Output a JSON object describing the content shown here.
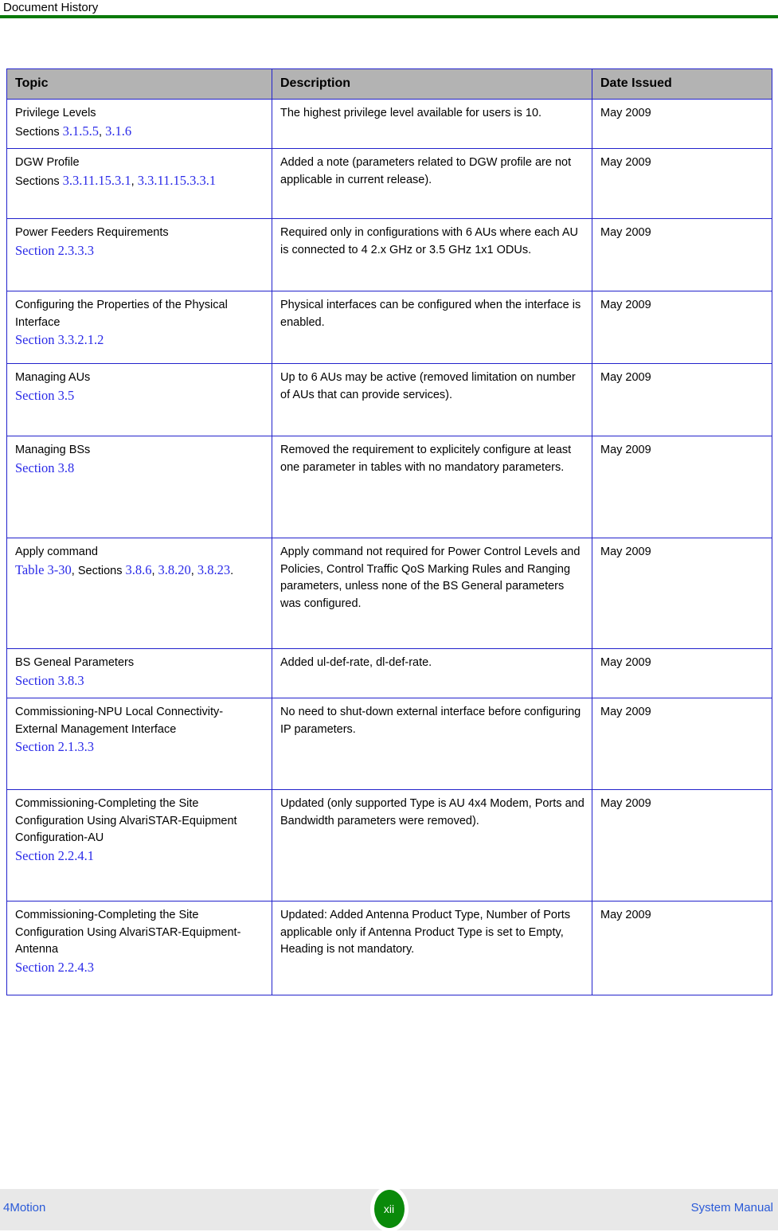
{
  "header": {
    "title": "Document History",
    "rule_color": "#0a7a0a"
  },
  "colors": {
    "link_blue": "#2a2ae8",
    "footer_link_blue": "#2a5ad8",
    "table_border_blue": "#2222cc",
    "table_header_gray": "#b3b3b3",
    "badge_green": "#0a8a0a",
    "footer_band_gray": "#e8e8e8"
  },
  "table": {
    "columns": [
      "Topic",
      "Description",
      "Date Issued"
    ],
    "rows": [
      {
        "topic_title": "Privilege Levels",
        "topic_refs_prefix": "Sections ",
        "topic_refs": [
          " 3.1.5.5",
          " 3.1.6"
        ],
        "topic_refs_separator": ", ",
        "topic_refs_suffix": "",
        "description": "The highest privilege level available for users is 10.",
        "date": "May 2009"
      },
      {
        "topic_title": "DGW Profile",
        "topic_refs_prefix": "Sections ",
        "topic_refs": [
          "3.3.11.15.3.1",
          " 3.3.11.15.3.3.1"
        ],
        "topic_refs_separator": ", ",
        "topic_refs_suffix": "",
        "description": "Added a note (parameters related to DGW profile are not applicable in current release).",
        "date": "May 2009"
      },
      {
        "topic_title": "Power Feeders Requirements",
        "topic_refs_prefix": "",
        "topic_refs": [
          "Section 2.3.3.3"
        ],
        "topic_refs_separator": ", ",
        "topic_refs_suffix": "",
        "description": "Required only in configurations with 6 AUs where each AU is connected to 4 2.x GHz or 3.5 GHz 1x1 ODUs.",
        "date": "May 2009"
      },
      {
        "topic_title": "Configuring the Properties of the Physical Interface",
        "topic_refs_prefix": "",
        "topic_refs": [
          "Section 3.3.2.1.2"
        ],
        "topic_refs_separator": ", ",
        "topic_refs_suffix": "",
        "description": "Physical interfaces can be configured when the interface is enabled.",
        "date": "May 2009"
      },
      {
        "topic_title": "Managing AUs",
        "topic_refs_prefix": "",
        "topic_refs": [
          "Section 3.5"
        ],
        "topic_refs_separator": ", ",
        "topic_refs_suffix": "",
        "description": "Up to 6 AUs may be active (removed limitation on number of AUs that can provide services).",
        "date": "May 2009"
      },
      {
        "topic_title": "Managing BSs",
        "topic_refs_prefix": "",
        "topic_refs": [
          "Section 3.8"
        ],
        "topic_refs_separator": ", ",
        "topic_refs_suffix": "",
        "description": "Removed the requirement to explicitely configure at least one parameter in tables with no mandatory parameters.",
        "date": "May 2009"
      },
      {
        "topic_title": "Apply command",
        "topic_refs_prefix": "",
        "topic_refs": [
          "Table 3-30"
        ],
        "topic_refs_separator": ", ",
        "topic_refs_suffix": "",
        "topic_refs_mid_text": ", Sections ",
        "topic_refs_2": [
          " 3.8.6",
          " 3.8.20",
          " 3.8.23"
        ],
        "topic_refs_end_text": ".",
        "description": "Apply command not required for Power Control Levels and Policies, Control Traffic QoS Marking Rules and Ranging parameters, unless none of the BS General parameters was configured.",
        "date": "May 2009"
      },
      {
        "topic_title": "BS Geneal Parameters",
        "topic_refs_prefix": "",
        "topic_refs": [
          "Section 3.8.3"
        ],
        "topic_refs_separator": ", ",
        "topic_refs_suffix": "",
        "description": "Added ul-def-rate, dl-def-rate.",
        "date": "May 2009"
      },
      {
        "topic_title": "Commissioning-NPU Local Connectivity-External Management Interface",
        "topic_refs_prefix": "",
        "topic_refs": [
          "Section 2.1.3.3"
        ],
        "topic_refs_separator": ", ",
        "topic_refs_suffix": "",
        "description": "No need to shut-down external interface before configuring IP parameters.",
        "date": "May 2009"
      },
      {
        "topic_title": "Commissioning-Completing the Site Configuration Using AlvariSTAR-Equipment Configuration-AU",
        "topic_refs_prefix": "",
        "topic_refs": [
          "Section 2.2.4.1"
        ],
        "topic_refs_separator": ", ",
        "topic_refs_suffix": "",
        "description": "Updated (only supported Type is AU 4x4 Modem, Ports and Bandwidth parameters were removed).",
        "date": "May 2009"
      },
      {
        "topic_title": "Commissioning-Completing the Site Configuration Using AlvariSTAR-Equipment-Antenna",
        "topic_refs_prefix": "",
        "topic_refs": [
          "Section 2.2.4.3"
        ],
        "topic_refs_separator": ", ",
        "topic_refs_suffix": "",
        "description": "Updated: Added Antenna Product Type, Number of Ports applicable only if Antenna Product Type is set to Empty, Heading is not mandatory.",
        "date": "May 2009"
      }
    ]
  },
  "footer": {
    "left": "4Motion",
    "page_number": "xii",
    "right": "System Manual"
  }
}
